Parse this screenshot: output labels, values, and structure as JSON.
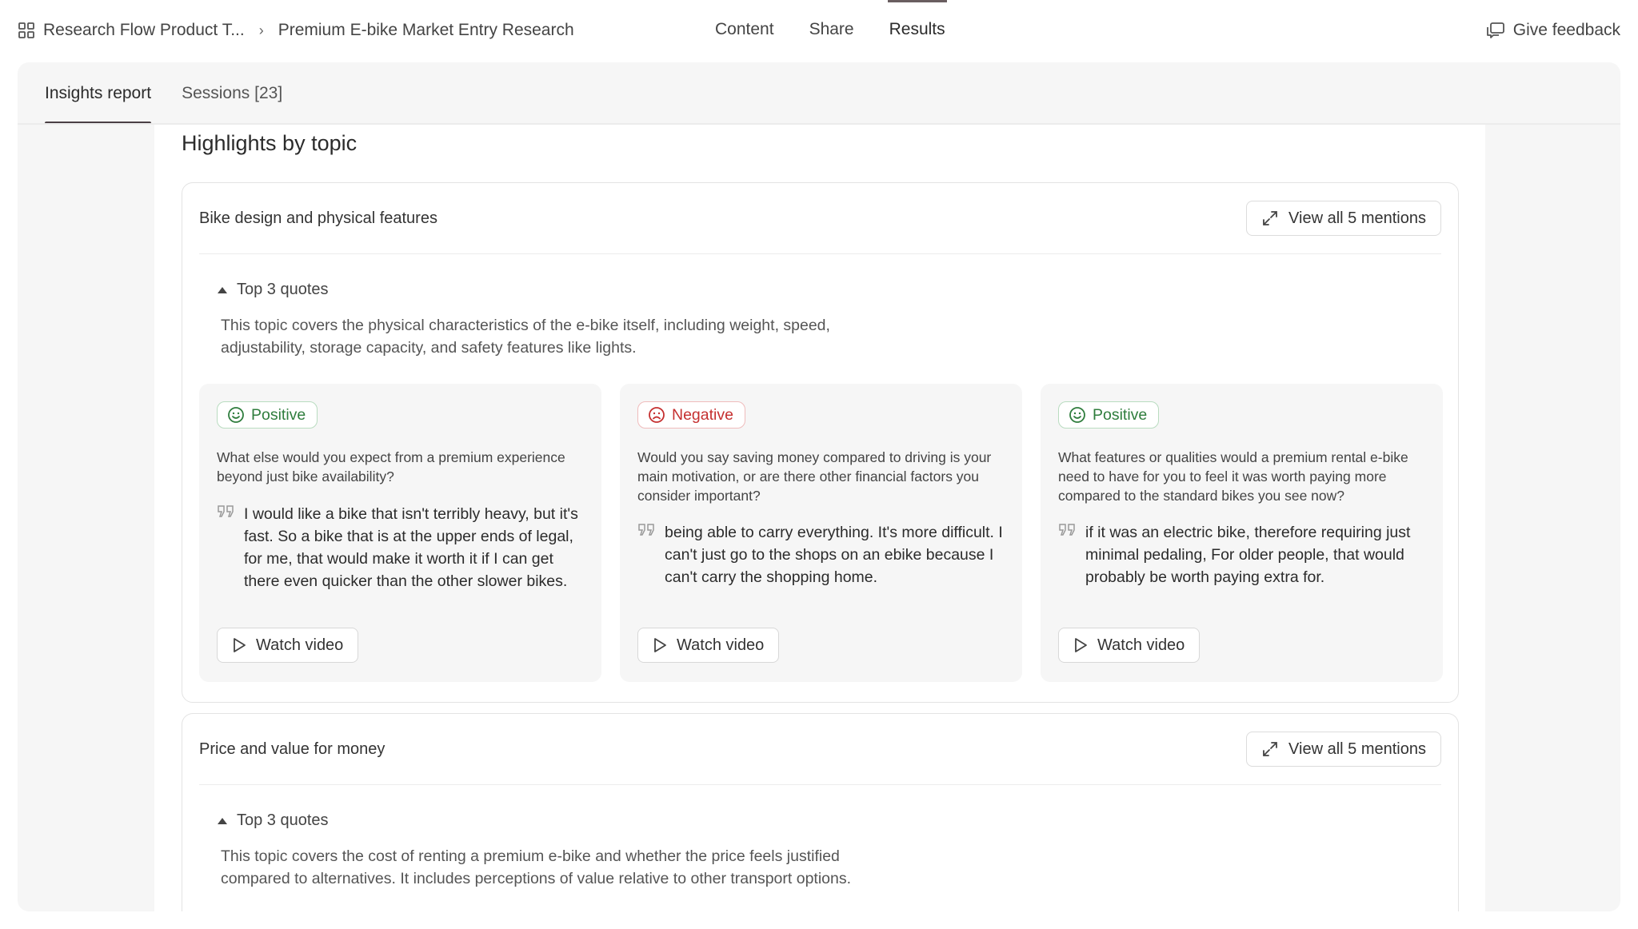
{
  "header": {
    "breadcrumb": [
      "Research Flow Product T...",
      "Premium E-bike Market Entry Research"
    ],
    "nav_tabs": [
      "Content",
      "Share",
      "Results"
    ],
    "active_nav": "Results",
    "feedback_label": "Give feedback"
  },
  "subtabs": [
    "Insights report",
    "Sessions [23]"
  ],
  "section_title": "Highlights by topic",
  "topics": [
    {
      "name": "Bike design and physical features",
      "view_all": "View all 5 mentions",
      "quotes_label": "Top 3 quotes",
      "description": "This topic covers the physical characteristics of the e-bike itself, including weight, speed, adjustability, storage capacity, and safety features like lights.",
      "cards": [
        {
          "sentiment": "Positive",
          "question": "What else would you expect from a premium experience beyond just bike availability?",
          "quote": "I would like a bike that isn't terribly heavy, but it's fast. So a bike that is at the upper ends of legal, for me, that would make it worth it if I can get there even quicker than the other slower bikes.",
          "watch": "Watch video"
        },
        {
          "sentiment": "Negative",
          "question": "Would you say saving money compared to driving is your main motivation, or are there other financial factors you consider important?",
          "quote": "being able to carry everything. It's more difficult. I can't just go to the shops on an ebike because I can't carry the shopping home.",
          "watch": "Watch video"
        },
        {
          "sentiment": "Positive",
          "question": "What features or qualities would a premium rental e-bike need to have for you to feel it was worth paying more compared to the standard bikes you see now?",
          "quote": "if it was an electric bike, therefore requiring just minimal pedaling, For older people, that would probably be worth paying extra for.",
          "watch": "Watch video"
        }
      ]
    },
    {
      "name": "Price and value for money",
      "view_all": "View all 5 mentions",
      "quotes_label": "Top 3 quotes",
      "description": "This topic covers the cost of renting a premium e-bike and whether the price feels justified compared to alternatives. It includes perceptions of value relative to other transport options."
    }
  ],
  "colors": {
    "positive": "#2f7d3d",
    "negative": "#c53030",
    "panel_bg": "#f6f6f6"
  }
}
